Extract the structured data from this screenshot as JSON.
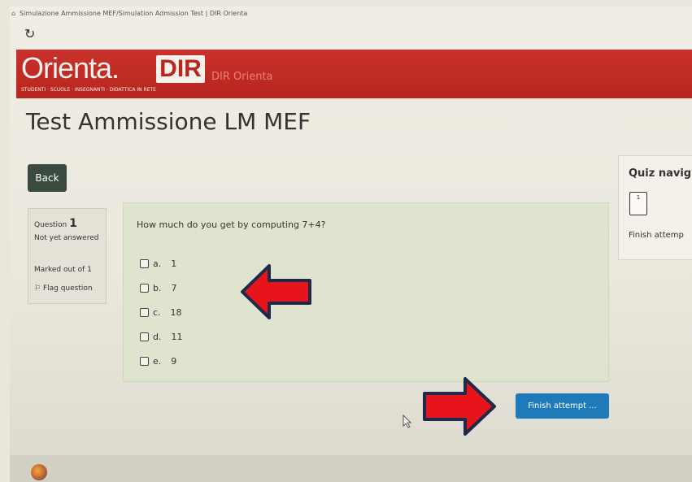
{
  "browser": {
    "tab_title": "Simulazione Ammissione MEF/Simulation Admission Test | DIR Orienta",
    "tab_icon": "home-icon",
    "reload_icon": "reload-icon"
  },
  "brand": {
    "logo_text": "Orienta.",
    "logo_dir": "DIR",
    "tagline": "STUDENTI · SCUOLE · INSEGNANTI · DIDATTICA IN RETE",
    "site_name": "DIR Orienta",
    "color": "#b7261f"
  },
  "page": {
    "title": "Test Ammissione LM MEF",
    "back_label": "Back"
  },
  "question_info": {
    "label": "Question",
    "number": "1",
    "state": "Not yet answered",
    "marks": "Marked out of 1",
    "flag_label": "Flag question",
    "flag_icon": "flag-icon"
  },
  "question": {
    "text": "How much do you get by computing 7+4?",
    "answers": [
      {
        "letter": "a.",
        "value": "1"
      },
      {
        "letter": "b.",
        "value": "7"
      },
      {
        "letter": "c.",
        "value": "18"
      },
      {
        "letter": "d.",
        "value": "11"
      },
      {
        "letter": "e.",
        "value": "9"
      }
    ]
  },
  "quiz_nav": {
    "title": "Quiz navig",
    "question_button": "1",
    "finish_link": "Finish attemp"
  },
  "actions": {
    "finish_label": "Finish attempt ..."
  },
  "annotations": {
    "arrow_color": "#e8141c",
    "arrow_outline": "#1d2a4a"
  }
}
